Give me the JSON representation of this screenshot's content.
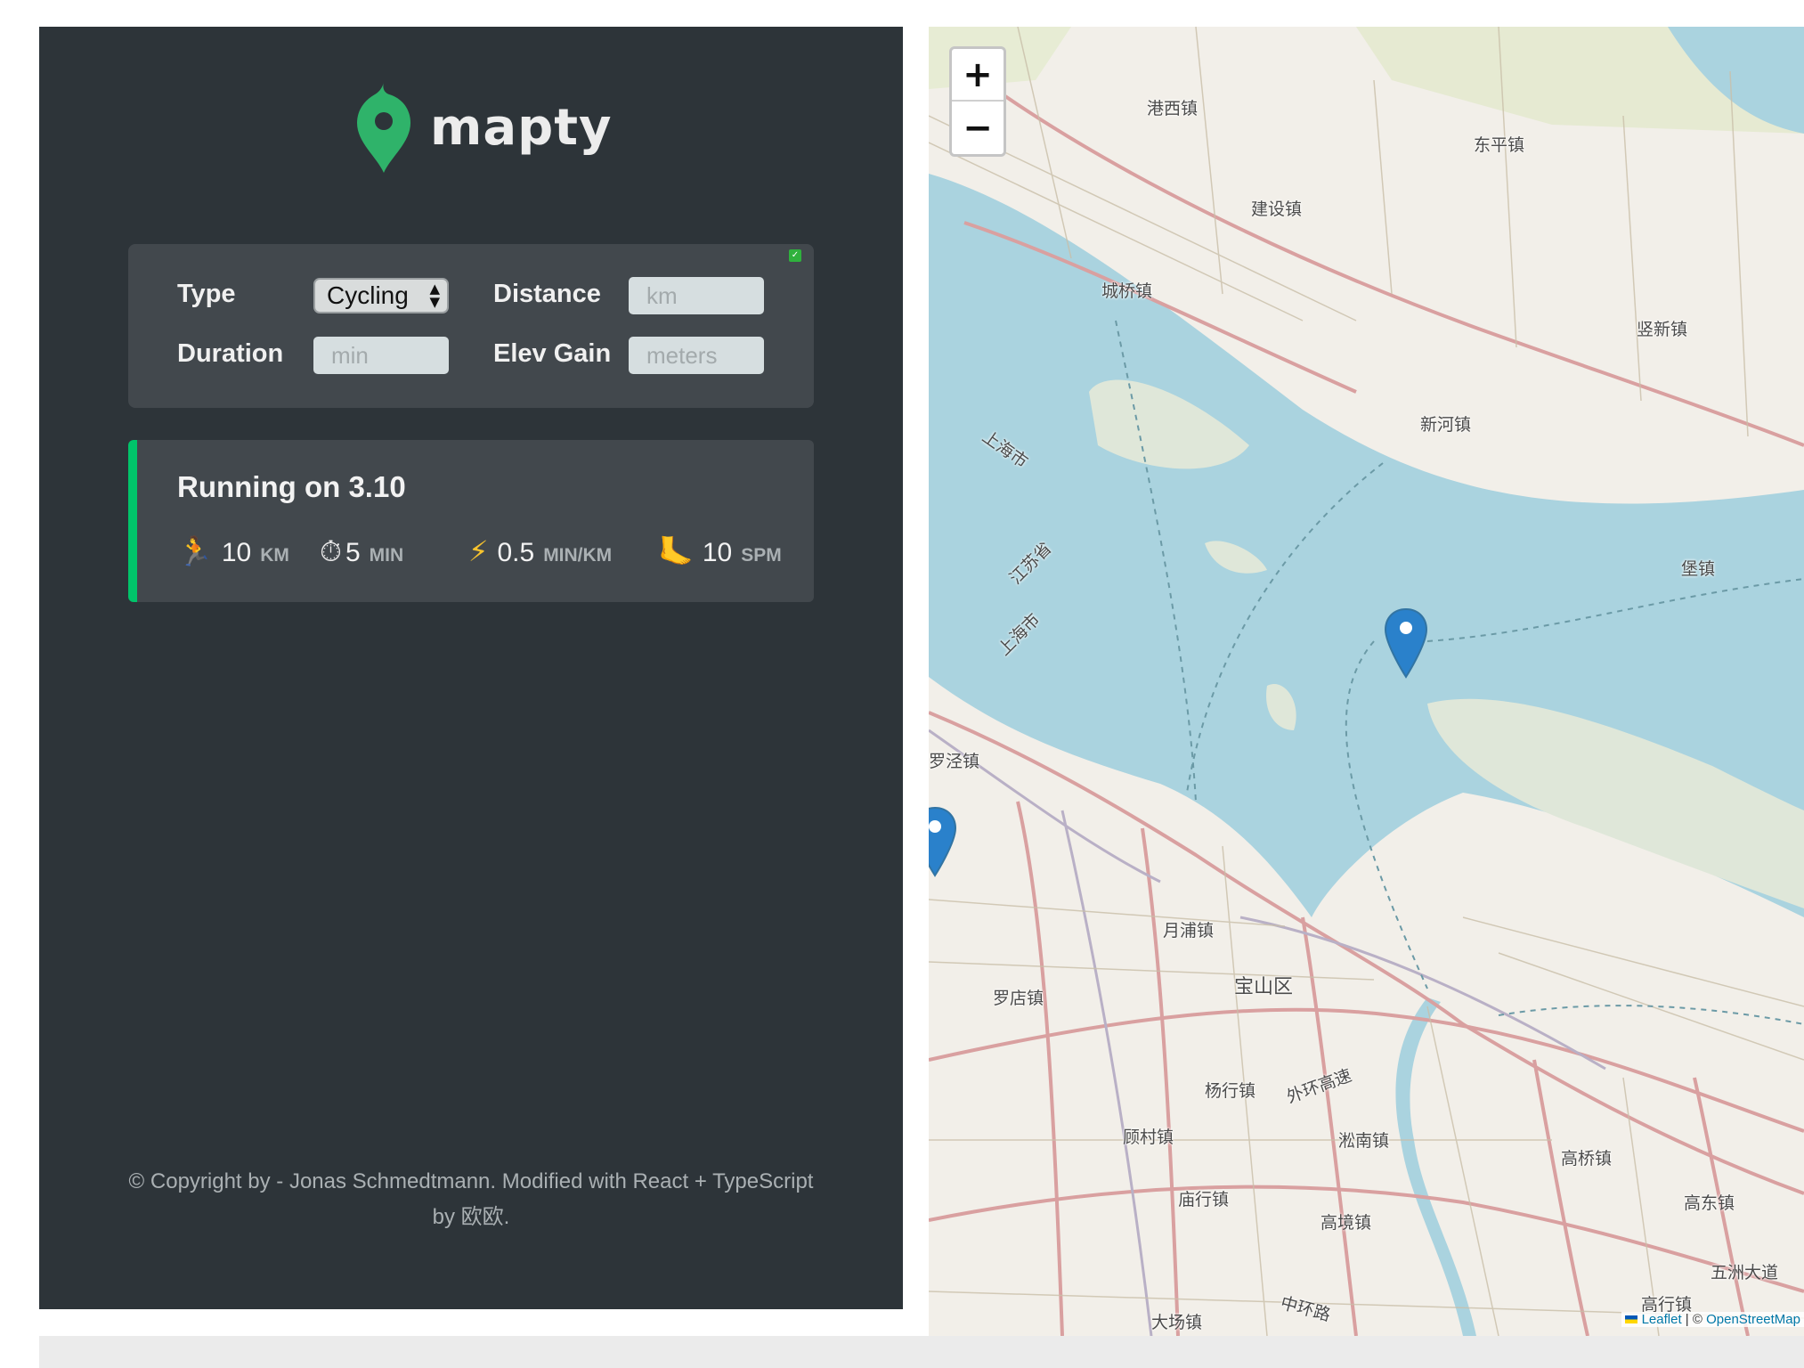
{
  "app": {
    "name": "mapty",
    "accent_color": "#00c46a"
  },
  "form": {
    "type_label": "Type",
    "type_value": "Cycling",
    "distance_label": "Distance",
    "distance_placeholder": "km",
    "duration_label": "Duration",
    "duration_placeholder": "min",
    "elev_label": "Elev Gain",
    "elev_placeholder": "meters"
  },
  "workouts": [
    {
      "title": "Running on 3.10",
      "type": "running",
      "stats": [
        {
          "icon": "runner-icon",
          "glyph": "🏃",
          "value": "10",
          "unit": "KM"
        },
        {
          "icon": "stopwatch-icon",
          "glyph": "⏱",
          "value": "5",
          "unit": "MIN"
        },
        {
          "icon": "lightning-icon",
          "glyph": "⚡",
          "value": "0.5",
          "unit": "MIN/KM"
        },
        {
          "icon": "footprint-icon",
          "glyph": "🦶",
          "value": "10",
          "unit": "SPM"
        }
      ]
    }
  ],
  "footer": {
    "copyright": "© Copyright by - Jonas Schmedtmann. Modified with React + TypeScript by 欧欧."
  },
  "map": {
    "zoom_in": "+",
    "zoom_out": "−",
    "places": [
      "港西镇",
      "东平镇",
      "建设镇",
      "城桥镇",
      "竖新镇",
      "新河镇",
      "堡镇",
      "上海市",
      "江苏省",
      "上海市",
      "罗泾镇",
      "月浦镇",
      "宝山区",
      "罗店镇",
      "杨行镇",
      "外环高速",
      "顾村镇",
      "淞南镇",
      "庙行镇",
      "高境镇",
      "高桥镇",
      "高东镇",
      "五洲大道",
      "高行镇",
      "大场镇",
      "中环路"
    ],
    "attribution_leaflet": "Leaflet",
    "attribution_sep": " | © ",
    "attribution_osm": "OpenStreetMap",
    "colors": {
      "water": "#aad3df",
      "land": "#f2efe9",
      "road": "#d9a0a0",
      "highway": "#c77f7f"
    }
  }
}
